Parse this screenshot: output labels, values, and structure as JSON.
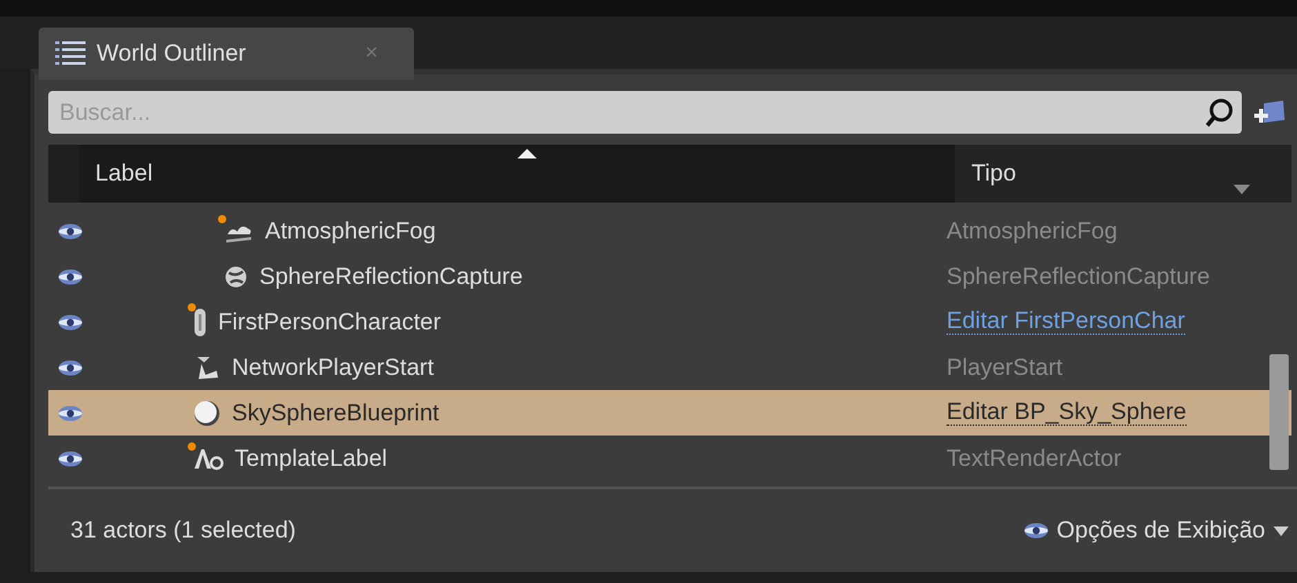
{
  "tab": {
    "title": "World Outliner",
    "close": "×"
  },
  "search": {
    "placeholder": "Buscar..."
  },
  "table": {
    "columns": [
      {
        "label": "Label",
        "sorted": true
      },
      {
        "label": "Tipo",
        "sorted": false
      }
    ],
    "rows": [
      {
        "children": [
          {
            "label": "AtmosphericFog",
            "kind": "fog",
            "dot": true,
            "visible": true,
            "selected": false,
            "type": {
              "kind": "text",
              "text": "AtmosphericFog"
            }
          },
          {
            "label": "SphereReflectionCapture",
            "kind": "sphere-capture",
            "dot": false,
            "visible": true,
            "selected": false,
            "type": {
              "kind": "text",
              "text": "SphereReflectionCapture"
            }
          }
        ]
      },
      {
        "label": "FirstPersonCharacter",
        "kind": "pawn",
        "dot": true,
        "visible": true,
        "selected": false,
        "type": {
          "kind": "link",
          "text": "Editar FirstPersonChar"
        }
      },
      {
        "label": "NetworkPlayerStart",
        "kind": "player-start",
        "dot": false,
        "visible": true,
        "selected": false,
        "type": {
          "kind": "text",
          "text": "PlayerStart"
        }
      },
      {
        "label": "SkySphereBlueprint",
        "kind": "ball",
        "dot": false,
        "visible": true,
        "selected": true,
        "type": {
          "kind": "link",
          "text": "Editar BP_Sky_Sphere"
        }
      },
      {
        "label": "TemplateLabel",
        "kind": "text-actor",
        "dot": true,
        "visible": true,
        "selected": false,
        "type": {
          "kind": "text",
          "text": "TextRenderActor"
        }
      }
    ]
  },
  "status": {
    "count": "31 actors (1 selected)",
    "view_options": "Opções de Exibição"
  }
}
